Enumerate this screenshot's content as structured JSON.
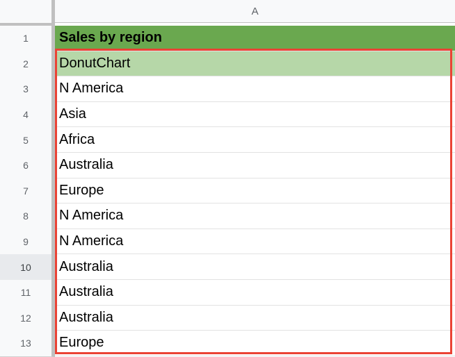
{
  "column_header": "A",
  "rows": [
    {
      "num": "1",
      "value": "Sales by region"
    },
    {
      "num": "2",
      "value": "DonutChart"
    },
    {
      "num": "3",
      "value": "N America"
    },
    {
      "num": "4",
      "value": "Asia"
    },
    {
      "num": "5",
      "value": "Africa"
    },
    {
      "num": "6",
      "value": "Australia"
    },
    {
      "num": "7",
      "value": "Europe"
    },
    {
      "num": "8",
      "value": "N America"
    },
    {
      "num": "9",
      "value": "N America"
    },
    {
      "num": "10",
      "value": "Australia"
    },
    {
      "num": "11",
      "value": "Australia"
    },
    {
      "num": "12",
      "value": "Australia"
    },
    {
      "num": "13",
      "value": "Europe"
    }
  ],
  "colors": {
    "header_fill": "#6aa84f",
    "highlight_fill": "#b6d7a8",
    "selection_border": "#ea4335"
  }
}
